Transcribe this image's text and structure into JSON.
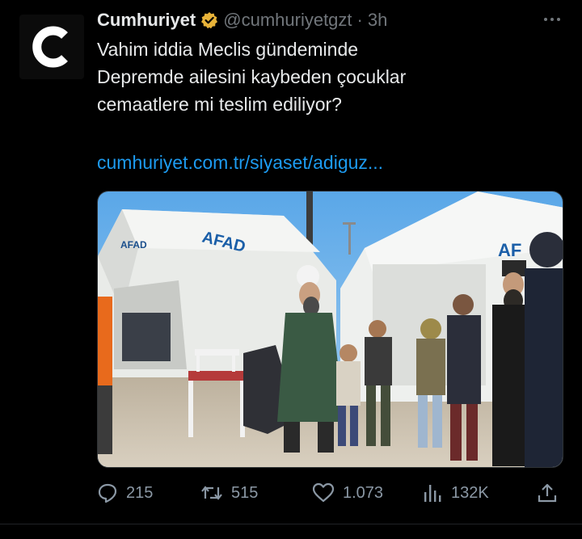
{
  "tweet": {
    "author_name": "Cumhuriyet",
    "handle": "@cumhuriyetgzt",
    "separator": "·",
    "time": "3h",
    "verified_badge_icon": "verified-badge-icon",
    "avatar_letter": "C",
    "text_lines": [
      "Vahim iddia Meclis gündeminde",
      "Depremde ailesini kaybeden çocuklar",
      "cemaatlere mi teslim ediliyor?"
    ],
    "link_text": "cumhuriyet.com.tr/siyaset/adiguz...",
    "photo_texts": {
      "tent_left_logo_small": "AFAD",
      "tent_left_logo_large": "AFAD",
      "tent_right_logo": "AF"
    }
  },
  "actions": {
    "replies": "215",
    "retweets": "515",
    "likes": "1.073",
    "views": "132K"
  },
  "colors": {
    "background": "#000000",
    "text": "#e7e9ea",
    "muted": "#71767b",
    "link": "#1d9bf0",
    "verified": "#e8b339"
  }
}
